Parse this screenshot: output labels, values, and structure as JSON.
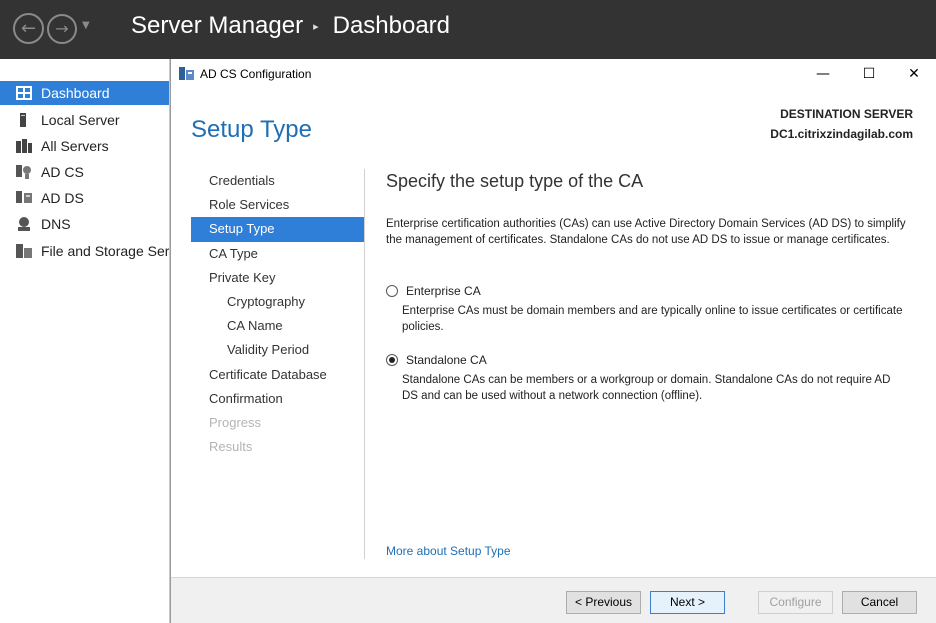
{
  "header": {
    "app": "Server Manager",
    "separator": "▸",
    "page": "Dashboard"
  },
  "sidebar": {
    "items": [
      {
        "label": "Dashboard",
        "icon": "dashboard-icon"
      },
      {
        "label": "Local Server",
        "icon": "server-icon"
      },
      {
        "label": "All Servers",
        "icon": "servers-icon"
      },
      {
        "label": "AD CS",
        "icon": "adcs-icon"
      },
      {
        "label": "AD DS",
        "icon": "adds-icon"
      },
      {
        "label": "DNS",
        "icon": "dns-icon"
      },
      {
        "label": "File and Storage Serv",
        "icon": "storage-icon"
      }
    ]
  },
  "dialog": {
    "title": "AD CS Configuration",
    "heading": "Setup Type",
    "destination_label": "DESTINATION SERVER",
    "destination_value": "DC1.citrixzindagilab.com",
    "steps": [
      {
        "label": "Credentials"
      },
      {
        "label": "Role Services"
      },
      {
        "label": "Setup Type"
      },
      {
        "label": "CA Type"
      },
      {
        "label": "Private Key"
      },
      {
        "label": "Cryptography"
      },
      {
        "label": "CA Name"
      },
      {
        "label": "Validity Period"
      },
      {
        "label": "Certificate Database"
      },
      {
        "label": "Confirmation"
      },
      {
        "label": "Progress"
      },
      {
        "label": "Results"
      }
    ],
    "content": {
      "heading": "Specify the setup type of the CA",
      "description": "Enterprise certification authorities (CAs) can use Active Directory Domain Services (AD DS) to simplify the management of certificates. Standalone CAs do not use AD DS to issue or manage certificates.",
      "options": [
        {
          "label": "Enterprise CA",
          "description": "Enterprise CAs must be domain members and are typically online to issue certificates or certificate policies.",
          "checked": false
        },
        {
          "label": "Standalone CA",
          "description": "Standalone CAs can be members or a workgroup or domain. Standalone CAs do not require AD DS and can be used without a network connection (offline).",
          "checked": true
        }
      ],
      "more_link": "More about Setup Type"
    },
    "buttons": {
      "previous": "< Previous",
      "next": "Next >",
      "configure": "Configure",
      "cancel": "Cancel"
    },
    "window_controls": {
      "minimize": "—",
      "maximize": "☐",
      "close": "✕"
    }
  }
}
